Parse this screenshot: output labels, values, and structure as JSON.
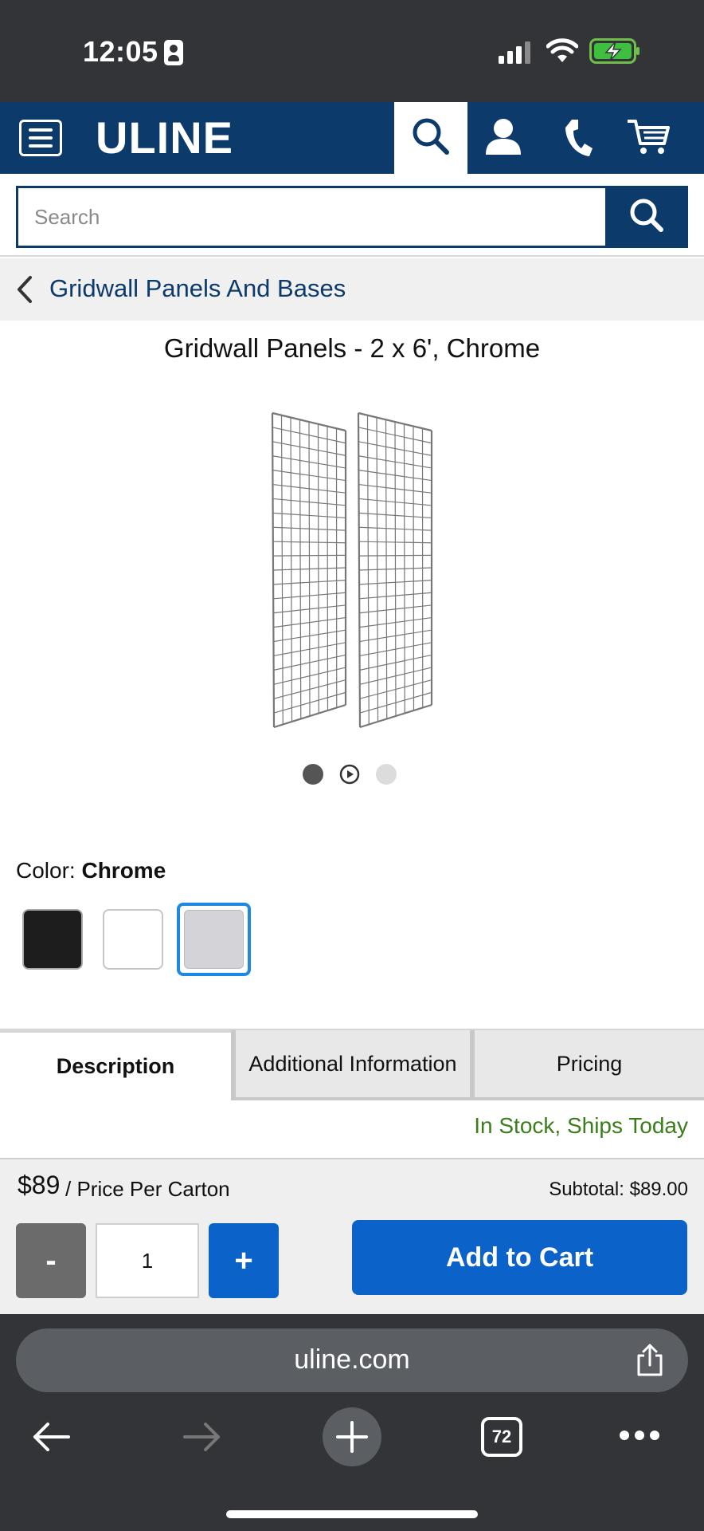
{
  "status_bar": {
    "time": "12:05"
  },
  "header": {
    "logo": "ULINE"
  },
  "search": {
    "placeholder": "Search"
  },
  "breadcrumb": {
    "label": "Gridwall Panels And Bases"
  },
  "product": {
    "title": "Gridwall Panels - 2 x 6', Chrome",
    "color_label": "Color:",
    "color_value": "Chrome",
    "swatches": [
      {
        "name": "Black",
        "color": "#1d1d1d"
      },
      {
        "name": "White",
        "color": "#ffffff"
      },
      {
        "name": "Chrome",
        "color": "#d4d3d8",
        "selected": true
      }
    ]
  },
  "tabs": [
    {
      "label": "Description",
      "active": true
    },
    {
      "label": "Additional Information",
      "active": false
    },
    {
      "label": "Pricing",
      "active": false
    }
  ],
  "stock": {
    "status": "In Stock, Ships Today"
  },
  "cart": {
    "price": "$89",
    "price_unit": "/ Price Per Carton",
    "subtotal": "Subtotal: $89.00",
    "minus_label": "-",
    "quantity": "1",
    "plus_label": "+",
    "add_label": "Add to Cart"
  },
  "browser": {
    "url": "uline.com",
    "tab_count": "72"
  },
  "colors": {
    "navy": "#0b3a6b",
    "accent_blue": "#0b63c9",
    "stock_green": "#3a7d1a",
    "selected_blue": "#1e88e5"
  }
}
